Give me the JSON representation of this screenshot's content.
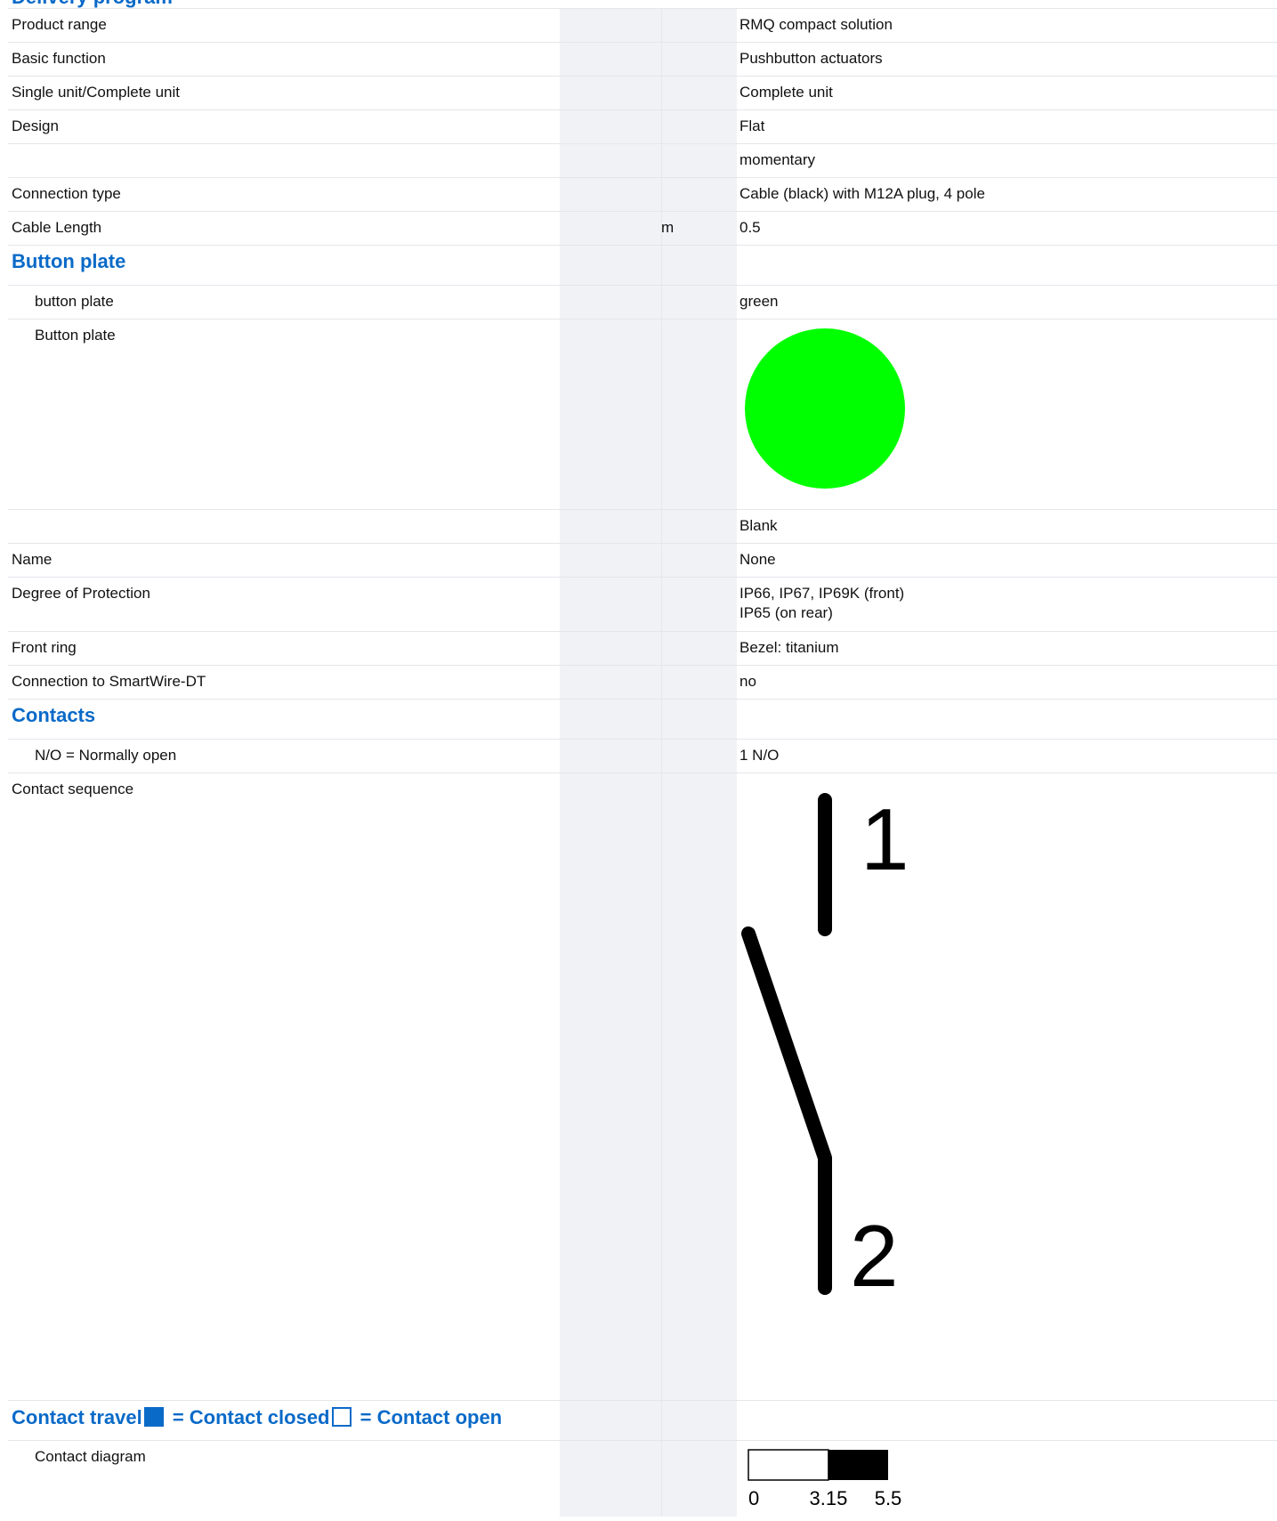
{
  "header": {
    "title": "Delivery program"
  },
  "rows": [
    {
      "label": "Product range",
      "unit": "",
      "value": "RMQ compact solution"
    },
    {
      "label": "Basic function",
      "unit": "",
      "value": "Pushbutton actuators"
    },
    {
      "label": "Single unit/Complete unit",
      "unit": "",
      "value": "Complete unit"
    },
    {
      "label": "Design",
      "unit": "",
      "value": "Flat"
    },
    {
      "label": "",
      "unit": "",
      "value": "momentary"
    },
    {
      "label": "Connection type",
      "unit": "",
      "value": "Cable (black) with M12A plug, 4 pole"
    },
    {
      "label": "Cable Length",
      "unit": "m",
      "value": "0.5"
    }
  ],
  "button_plate_section": {
    "heading": "Button plate",
    "color_label": "button plate",
    "color_value": "green",
    "image_label": "Button plate",
    "image_color": "#00ff00"
  },
  "rows2": [
    {
      "label": "",
      "value": "Blank"
    },
    {
      "label": "Name",
      "value": "None"
    },
    {
      "label": "Degree of Protection",
      "value": "IP66, IP67, IP69K (front)",
      "value2": "IP65 (on rear)"
    },
    {
      "label": "Front ring",
      "value": "Bezel: titanium"
    },
    {
      "label": "Connection to SmartWire-DT",
      "value": "no"
    }
  ],
  "contacts_section": {
    "heading": "Contacts",
    "no_label": "N/O = Normally open",
    "no_value": "1 N/O",
    "sequence_label": "Contact sequence",
    "terminal_top": "1",
    "terminal_bottom": "2"
  },
  "travel_section": {
    "heading_part1": "Contact travel",
    "heading_part2": " = Contact closed",
    "heading_part3": " = Contact open",
    "diagram_label": "Contact diagram",
    "diagram": {
      "open_until": 3.15,
      "max": 5.5,
      "tick_labels": [
        "0",
        "3.15",
        "5.5"
      ]
    },
    "legend_closed_color": "#0a6ac8"
  }
}
